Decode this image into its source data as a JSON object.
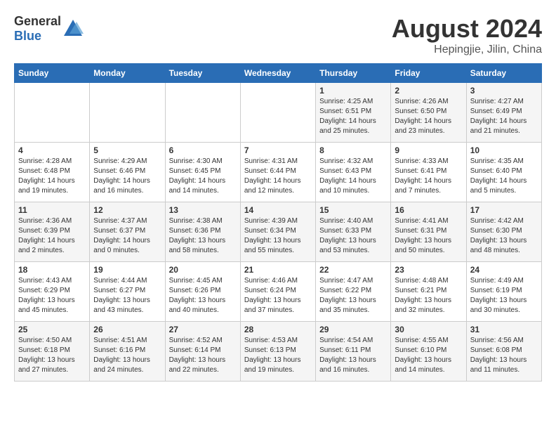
{
  "logo": {
    "general": "General",
    "blue": "Blue"
  },
  "title": "August 2024",
  "subtitle": "Hepingjie, Jilin, China",
  "days_of_week": [
    "Sunday",
    "Monday",
    "Tuesday",
    "Wednesday",
    "Thursday",
    "Friday",
    "Saturday"
  ],
  "weeks": [
    [
      {
        "day": "",
        "info": ""
      },
      {
        "day": "",
        "info": ""
      },
      {
        "day": "",
        "info": ""
      },
      {
        "day": "",
        "info": ""
      },
      {
        "day": "1",
        "info": "Sunrise: 4:25 AM\nSunset: 6:51 PM\nDaylight: 14 hours\nand 25 minutes."
      },
      {
        "day": "2",
        "info": "Sunrise: 4:26 AM\nSunset: 6:50 PM\nDaylight: 14 hours\nand 23 minutes."
      },
      {
        "day": "3",
        "info": "Sunrise: 4:27 AM\nSunset: 6:49 PM\nDaylight: 14 hours\nand 21 minutes."
      }
    ],
    [
      {
        "day": "4",
        "info": "Sunrise: 4:28 AM\nSunset: 6:48 PM\nDaylight: 14 hours\nand 19 minutes."
      },
      {
        "day": "5",
        "info": "Sunrise: 4:29 AM\nSunset: 6:46 PM\nDaylight: 14 hours\nand 16 minutes."
      },
      {
        "day": "6",
        "info": "Sunrise: 4:30 AM\nSunset: 6:45 PM\nDaylight: 14 hours\nand 14 minutes."
      },
      {
        "day": "7",
        "info": "Sunrise: 4:31 AM\nSunset: 6:44 PM\nDaylight: 14 hours\nand 12 minutes."
      },
      {
        "day": "8",
        "info": "Sunrise: 4:32 AM\nSunset: 6:43 PM\nDaylight: 14 hours\nand 10 minutes."
      },
      {
        "day": "9",
        "info": "Sunrise: 4:33 AM\nSunset: 6:41 PM\nDaylight: 14 hours\nand 7 minutes."
      },
      {
        "day": "10",
        "info": "Sunrise: 4:35 AM\nSunset: 6:40 PM\nDaylight: 14 hours\nand 5 minutes."
      }
    ],
    [
      {
        "day": "11",
        "info": "Sunrise: 4:36 AM\nSunset: 6:39 PM\nDaylight: 14 hours\nand 2 minutes."
      },
      {
        "day": "12",
        "info": "Sunrise: 4:37 AM\nSunset: 6:37 PM\nDaylight: 14 hours\nand 0 minutes."
      },
      {
        "day": "13",
        "info": "Sunrise: 4:38 AM\nSunset: 6:36 PM\nDaylight: 13 hours\nand 58 minutes."
      },
      {
        "day": "14",
        "info": "Sunrise: 4:39 AM\nSunset: 6:34 PM\nDaylight: 13 hours\nand 55 minutes."
      },
      {
        "day": "15",
        "info": "Sunrise: 4:40 AM\nSunset: 6:33 PM\nDaylight: 13 hours\nand 53 minutes."
      },
      {
        "day": "16",
        "info": "Sunrise: 4:41 AM\nSunset: 6:31 PM\nDaylight: 13 hours\nand 50 minutes."
      },
      {
        "day": "17",
        "info": "Sunrise: 4:42 AM\nSunset: 6:30 PM\nDaylight: 13 hours\nand 48 minutes."
      }
    ],
    [
      {
        "day": "18",
        "info": "Sunrise: 4:43 AM\nSunset: 6:29 PM\nDaylight: 13 hours\nand 45 minutes."
      },
      {
        "day": "19",
        "info": "Sunrise: 4:44 AM\nSunset: 6:27 PM\nDaylight: 13 hours\nand 43 minutes."
      },
      {
        "day": "20",
        "info": "Sunrise: 4:45 AM\nSunset: 6:26 PM\nDaylight: 13 hours\nand 40 minutes."
      },
      {
        "day": "21",
        "info": "Sunrise: 4:46 AM\nSunset: 6:24 PM\nDaylight: 13 hours\nand 37 minutes."
      },
      {
        "day": "22",
        "info": "Sunrise: 4:47 AM\nSunset: 6:22 PM\nDaylight: 13 hours\nand 35 minutes."
      },
      {
        "day": "23",
        "info": "Sunrise: 4:48 AM\nSunset: 6:21 PM\nDaylight: 13 hours\nand 32 minutes."
      },
      {
        "day": "24",
        "info": "Sunrise: 4:49 AM\nSunset: 6:19 PM\nDaylight: 13 hours\nand 30 minutes."
      }
    ],
    [
      {
        "day": "25",
        "info": "Sunrise: 4:50 AM\nSunset: 6:18 PM\nDaylight: 13 hours\nand 27 minutes."
      },
      {
        "day": "26",
        "info": "Sunrise: 4:51 AM\nSunset: 6:16 PM\nDaylight: 13 hours\nand 24 minutes."
      },
      {
        "day": "27",
        "info": "Sunrise: 4:52 AM\nSunset: 6:14 PM\nDaylight: 13 hours\nand 22 minutes."
      },
      {
        "day": "28",
        "info": "Sunrise: 4:53 AM\nSunset: 6:13 PM\nDaylight: 13 hours\nand 19 minutes."
      },
      {
        "day": "29",
        "info": "Sunrise: 4:54 AM\nSunset: 6:11 PM\nDaylight: 13 hours\nand 16 minutes."
      },
      {
        "day": "30",
        "info": "Sunrise: 4:55 AM\nSunset: 6:10 PM\nDaylight: 13 hours\nand 14 minutes."
      },
      {
        "day": "31",
        "info": "Sunrise: 4:56 AM\nSunset: 6:08 PM\nDaylight: 13 hours\nand 11 minutes."
      }
    ]
  ]
}
